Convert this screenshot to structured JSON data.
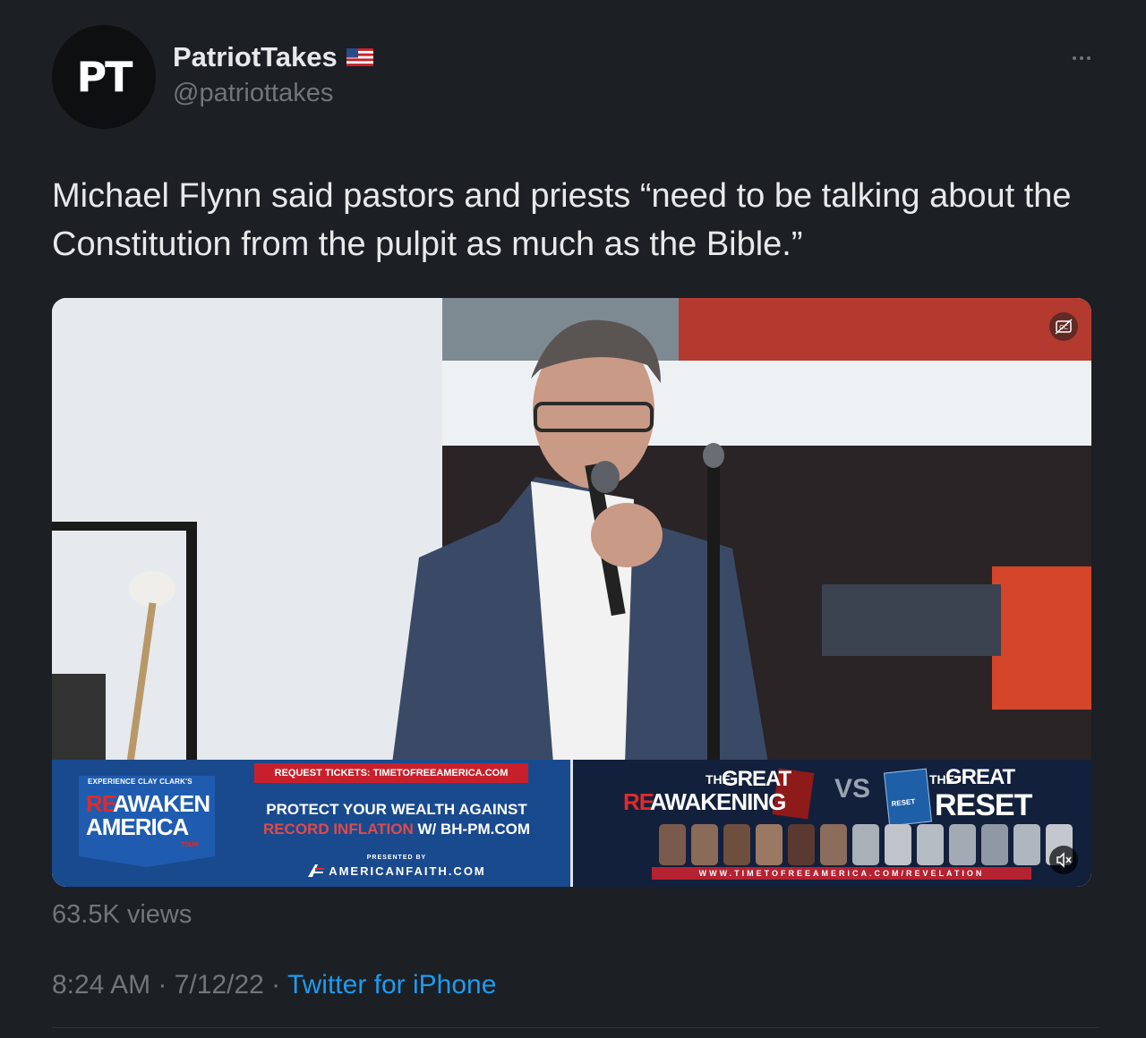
{
  "author": {
    "avatar_initials": "PT",
    "display_name": "PatriotTakes",
    "flag_icon": "us-flag-icon",
    "handle": "@patriottakes"
  },
  "more_icon": "more-options-icon",
  "tweet": {
    "text": "Michael Flynn said pastors and priests “need to be talking about the Constitution from the pulpit as much as the Bible.”"
  },
  "video": {
    "cc_icon": "captions-icon",
    "mute_icon": "muted-speaker-icon",
    "banner_left": {
      "experience": "EXPERIENCE CLAY CLARK'S",
      "brand_re": "RE",
      "brand_awaken": "AWAKEN",
      "brand_america": "AMERICA",
      "brand_tour": "TOUR",
      "tickets": "REQUEST TICKETS: TIMETOFREEAMERICA.COM",
      "promo_line1": "PROTECT YOUR WEALTH AGAINST",
      "promo_line2_red": "RECORD INFLATION",
      "promo_line2_white": " W/ BH-PM.COM",
      "presented_by": "PRESENTED BY",
      "sponsor": "AMERICANFAITH.COM"
    },
    "banner_right": {
      "awakening_the": "THE",
      "awakening_great": "GREAT",
      "awakening_re": "RE",
      "awakening_word": "AWAKENING",
      "vs": "VS",
      "reset_book": "RESET",
      "reset_the": "THE",
      "reset_great": "GREAT",
      "reset_word": "RESET",
      "url": "WWW.TIMETOFREEAMERICA.COM/REVELATION"
    }
  },
  "stats": {
    "views": "63.5K views"
  },
  "meta": {
    "time": "8:24 AM",
    "sep1": " · ",
    "date": "7/12/22",
    "sep2": " · ",
    "source": "Twitter for iPhone"
  },
  "colors": {
    "background": "#1c1f24",
    "text": "#e7e9ea",
    "muted": "#71767b",
    "link": "#1d9bf0",
    "banner_blue": "#1a4a8e",
    "banner_red": "#c8202a"
  }
}
